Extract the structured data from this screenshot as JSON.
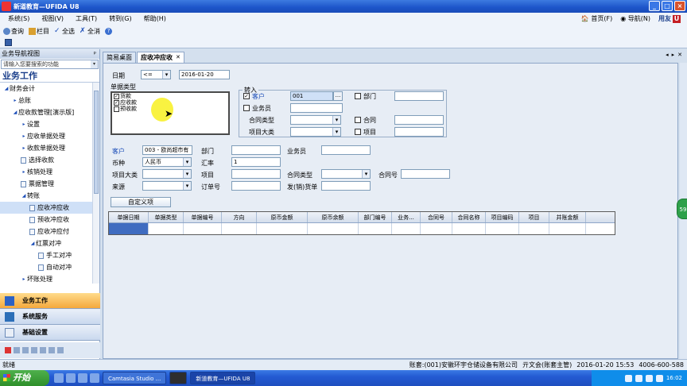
{
  "window": {
    "title": "新道教育—UFIDA U8"
  },
  "menu": [
    "系统(S)",
    "视图(V)",
    "工具(T)",
    "转到(G)",
    "帮助(H)"
  ],
  "menu_right": {
    "home": "首页(F)",
    "nav": "导航(N)",
    "brand": "用友"
  },
  "toolbar": {
    "query": "查询",
    "columns": "栏目",
    "select_all": "全选",
    "deselect_all": "全消"
  },
  "left": {
    "header": "业务导航视图",
    "search_placeholder": "请输入您要搜索的功能",
    "section": "业务工作",
    "tree": [
      {
        "label": "财务会计",
        "indent": 0,
        "type": "open"
      },
      {
        "label": "总账",
        "indent": 1,
        "type": "closed"
      },
      {
        "label": "应收款管理[演示版]",
        "indent": 1,
        "type": "open"
      },
      {
        "label": "设置",
        "indent": 2,
        "type": "closed"
      },
      {
        "label": "应收单据处理",
        "indent": 2,
        "type": "closed"
      },
      {
        "label": "收款单据处理",
        "indent": 2,
        "type": "closed"
      },
      {
        "label": "选择收款",
        "indent": 2,
        "type": "doc"
      },
      {
        "label": "核销处理",
        "indent": 2,
        "type": "closed"
      },
      {
        "label": "票据管理",
        "indent": 2,
        "type": "doc"
      },
      {
        "label": "转账",
        "indent": 2,
        "type": "open"
      },
      {
        "label": "应收冲应收",
        "indent": 3,
        "type": "doc",
        "selected": true
      },
      {
        "label": "预收冲应收",
        "indent": 3,
        "type": "doc"
      },
      {
        "label": "应收冲应付",
        "indent": 3,
        "type": "doc"
      },
      {
        "label": "红票对冲",
        "indent": 3,
        "type": "open"
      },
      {
        "label": "手工对冲",
        "indent": 4,
        "type": "doc"
      },
      {
        "label": "自动对冲",
        "indent": 4,
        "type": "doc"
      },
      {
        "label": "坏账处理",
        "indent": 2,
        "type": "closed"
      }
    ],
    "nav_buttons": [
      "业务工作",
      "系统服务",
      "基础设置"
    ]
  },
  "tabs": [
    "简易桌面",
    "应收冲应收"
  ],
  "form": {
    "date_label": "日期",
    "date_op": "<=",
    "date_value": "2016-01-20",
    "bill_type_title": "单据类型",
    "bill_types": [
      {
        "label": "货款",
        "checked": true
      },
      {
        "label": "应收款",
        "checked": true
      },
      {
        "label": "预收款",
        "checked": false
      }
    ],
    "transfer_in_title": "转入",
    "in_customer_label": "客户",
    "in_customer_value": "001",
    "in_dept_label": "部门",
    "in_staff_label": "业务员",
    "in_contract_type_label": "合同类型",
    "in_contract_label": "合同",
    "in_project_cat_label": "项目大类",
    "in_project_label": "项目",
    "customer_label": "客户",
    "customer_value": "003 - 欧尚超市有",
    "dept_label": "部门",
    "staff_label": "业务员",
    "currency_label": "币种",
    "currency_value": "人民币",
    "rate_label": "汇率",
    "rate_value": "1",
    "project_cat_label": "项目大类",
    "project_label": "项目",
    "contract_type_label": "合同类型",
    "contract_no_label": "合同号",
    "source_label": "来源",
    "order_no_label": "订单号",
    "invoice_label": "发(销)货单",
    "custom_btn": "自定义项"
  },
  "grid": {
    "columns": [
      "单据日期",
      "单据类型",
      "单据编号",
      "方向",
      "原币金额",
      "原币余额",
      "部门编号",
      "业务...",
      "合同号",
      "合同名称",
      "项目编码",
      "项目",
      "并账金额"
    ]
  },
  "status": {
    "left": "就绪",
    "account": "账套:(001)安徽环宇仓储设备有限公司",
    "user": "亓文会(账套主管)",
    "date": "2016-01-20 15:53",
    "phone": "4006-600-588"
  },
  "taskbar": {
    "start": "开始",
    "tasks": [
      "Camtasia Studio ...",
      "",
      "新道教育—UFIDA U8"
    ],
    "clock": "16:02"
  }
}
